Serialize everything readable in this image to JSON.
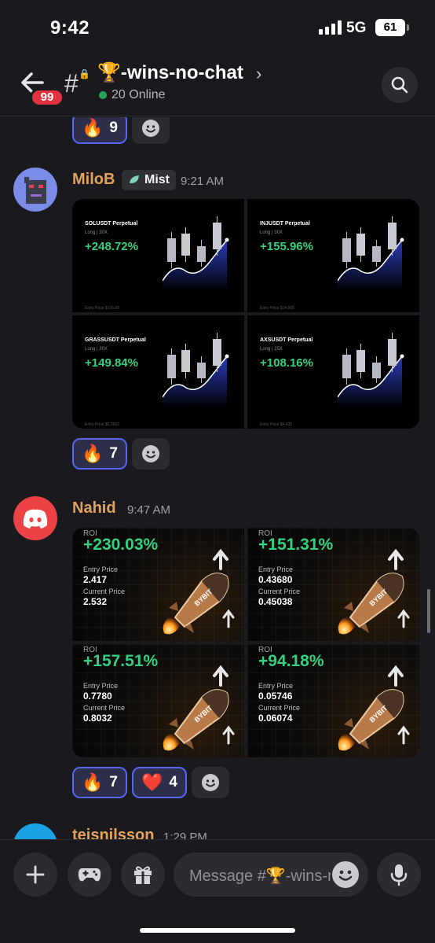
{
  "status": {
    "time": "9:42",
    "network": "5G",
    "battery": "61"
  },
  "header": {
    "badge": "99",
    "channel_emoji": "🏆",
    "channel_name": "-wins-no-chat",
    "online": "20 Online"
  },
  "top_reactions": [
    {
      "emoji": "🔥",
      "count": "9"
    }
  ],
  "messages": [
    {
      "author": "MiloB",
      "role_tag": "Mist",
      "time": "9:21 AM",
      "tiles": [
        {
          "pair": "SOLUSDT Perpetual",
          "sub": "Long | 30X",
          "roi": "+248.72%",
          "foot": "Entry Price    $176.68"
        },
        {
          "pair": "INJUSDT Perpetual",
          "sub": "Long | 30X",
          "roi": "+155.96%",
          "foot": "Entry Price    $14.005"
        },
        {
          "pair": "GRASSUSDT Perpetual",
          "sub": "Long | 30X",
          "roi": "+149.84%",
          "foot": "Entry Price    $0.3663"
        },
        {
          "pair": "AXSUSDT Perpetual",
          "sub": "Long | 25X",
          "roi": "+108.16%",
          "foot": "Entry Price    $4.431"
        }
      ],
      "reactions": [
        {
          "emoji": "🔥",
          "count": "7"
        }
      ]
    },
    {
      "author": "Nahid",
      "time": "9:47 AM",
      "tiles": [
        {
          "roi_label": "ROI",
          "roi": "+230.03%",
          "entry_label": "Entry Price",
          "entry": "2.417",
          "current_label": "Current Price",
          "current": "2.532",
          "brand": "BYBIT"
        },
        {
          "roi_label": "ROI",
          "roi": "+151.31%",
          "entry_label": "Entry Price",
          "entry": "0.43680",
          "current_label": "Current Price",
          "current": "0.45038",
          "brand": "BYBIT"
        },
        {
          "roi_label": "ROI",
          "roi": "+157.51%",
          "entry_label": "Entry Price",
          "entry": "0.7780",
          "current_label": "Current Price",
          "current": "0.8032",
          "brand": "BYBIT"
        },
        {
          "roi_label": "ROI",
          "roi": "+94.18%",
          "entry_label": "Entry Price",
          "entry": "0.05746",
          "current_label": "Current Price",
          "current": "0.06074",
          "brand": "BYBIT"
        }
      ],
      "reactions": [
        {
          "emoji": "🔥",
          "count": "7"
        },
        {
          "emoji": "❤️",
          "count": "4"
        }
      ]
    },
    {
      "author": "teisnilsson",
      "time": "1:29 PM"
    }
  ],
  "composer": {
    "placeholder": "Message #🏆-wins-no-chat"
  },
  "colors": {
    "background": "#1a1a1e",
    "accent": "#5865f2",
    "author": "#e3a25a",
    "profit": "#35d07f",
    "online": "#23a559",
    "badge": "#e3313f"
  }
}
